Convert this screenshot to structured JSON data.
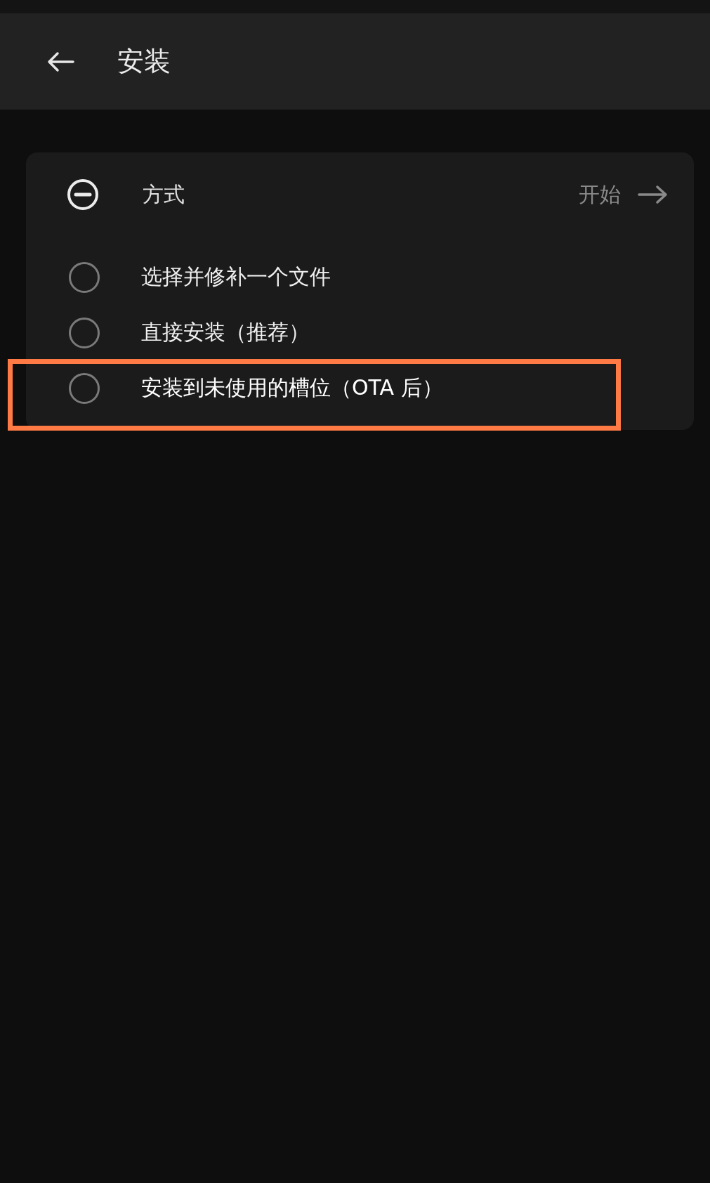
{
  "app_bar": {
    "title": "安装"
  },
  "card": {
    "title": "方式",
    "action": "开始",
    "expanded": true,
    "options": [
      {
        "label": "选择并修补一个文件",
        "selected": false,
        "highlighted": false
      },
      {
        "label": "直接安装（推荐）",
        "selected": false,
        "highlighted": false
      },
      {
        "label": "安装到未使用的槽位（OTA 后）",
        "selected": false,
        "highlighted": true
      }
    ]
  }
}
